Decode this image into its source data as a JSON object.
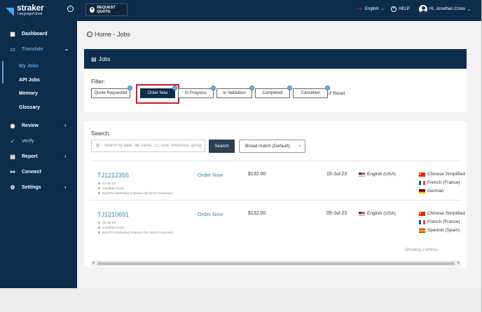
{
  "header": {
    "brand": "straker",
    "brand_sub": "LanguageCloud",
    "request_quote": "REQUEST QUOTE",
    "language": "English",
    "help": "HELP",
    "user_greeting": "Hi, Jonathan Cross"
  },
  "sidebar": {
    "items": [
      {
        "label": "Dashboard",
        "icon": "dashboard-icon"
      },
      {
        "label": "Translate",
        "icon": "translate-icon"
      },
      {
        "label": "Review",
        "icon": "review-icon"
      },
      {
        "label": "Verify",
        "icon": "verify-icon"
      },
      {
        "label": "Report",
        "icon": "report-icon"
      },
      {
        "label": "Connect",
        "icon": "connect-icon"
      },
      {
        "label": "Settings",
        "icon": "settings-icon"
      }
    ],
    "sub_items": [
      {
        "label": "My Jobs"
      },
      {
        "label": "API Jobs"
      },
      {
        "label": "Memory"
      },
      {
        "label": "Glossary"
      }
    ]
  },
  "breadcrumb": "Home - Jobs",
  "jobs_title": "Jobs",
  "filter": {
    "label": "Filter:",
    "reset": "Reset",
    "chips": [
      {
        "label": "Quote Requested",
        "count": "0"
      },
      {
        "label": "Order Now",
        "count": "2"
      },
      {
        "label": "In Progress",
        "count": "0"
      },
      {
        "label": "In Validation",
        "count": "0"
      },
      {
        "label": "Completed",
        "count": "0"
      },
      {
        "label": "Cancelled",
        "count": "0"
      }
    ]
  },
  "search": {
    "label": "Search:",
    "placeholder": "Search by date, file name, TJ, user, reference, group",
    "button": "Search",
    "match": "Broad match (Default)"
  },
  "jobs": [
    {
      "id": "TJ1212355",
      "date_small": "13-Jul-23",
      "user": "Jonathan Cross",
      "company": "BuzzPro Marketing Solutions (for Demo Purposes)",
      "status": "Order Now",
      "price": "$132.00",
      "date": "15-Jul-23",
      "source": "English (USA)",
      "targets": [
        "Chinese Simplified",
        "French (France)",
        "German"
      ]
    },
    {
      "id": "TJ1210691",
      "date_small": "03-Jul-23",
      "user": "Jonathan Cross",
      "company": "BuzzPro Marketing Solutions (for Demo Purposes)",
      "status": "Order Now",
      "price": "$132.00",
      "date": "05-Jul-23",
      "source": "English (USA)",
      "targets": [
        "Chinese Simplified",
        "French (France)",
        "Spanish (Spain)"
      ]
    }
  ],
  "showing": "Showing 2 entries"
}
